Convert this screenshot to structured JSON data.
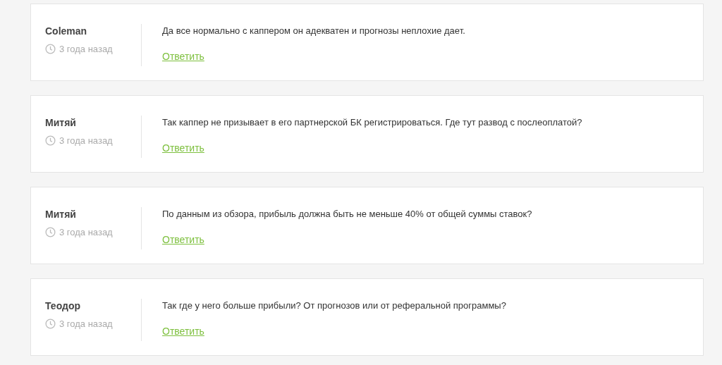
{
  "comments": [
    {
      "author": "Coleman",
      "time": "3 года назад",
      "text": "Да все нормально с каппером он адекватен и прогнозы неплохие дает.",
      "reply": "Ответить"
    },
    {
      "author": "Митяй",
      "time": "3 года назад",
      "text": "Так каппер не призывает в его партнерской БК регистрироваться. Где тут развод с послеоплатой?",
      "reply": "Ответить"
    },
    {
      "author": "Митяй",
      "time": "3 года назад",
      "text": "По данным из обзора, прибыль должна быть не меньше 40% от общей суммы ставок?",
      "reply": "Ответить"
    },
    {
      "author": "Теодор",
      "time": "3 года назад",
      "text": "Так где у него больше прибыли? От прогнозов или от реферальной программы?",
      "reply": "Ответить"
    }
  ]
}
